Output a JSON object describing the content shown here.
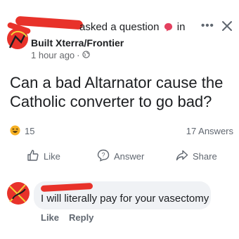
{
  "post": {
    "asked_text": "asked a question",
    "in_text": "in",
    "group_name": "Built Xterra/Frontier",
    "time": "1 hour ago",
    "more_icon": "more-dots-icon",
    "close_icon": "close-icon",
    "question": "Can a bad Altarnator cause the Catholic converter to go bad?"
  },
  "stats": {
    "reaction_icon": "haha-emoji-icon",
    "reaction_count": "15",
    "answers": "17 Answers"
  },
  "actions": {
    "like": "Like",
    "answer": "Answer",
    "share": "Share"
  },
  "comment": {
    "text": "I will literally pay for your vasectomy",
    "like": "Like",
    "reply": "Reply"
  },
  "colors": {
    "redaction": "#e8322a",
    "secondary_text": "#606770",
    "bubble": "#f0f2f5",
    "emoji": "#f7b125",
    "badge": "#e4405f"
  }
}
